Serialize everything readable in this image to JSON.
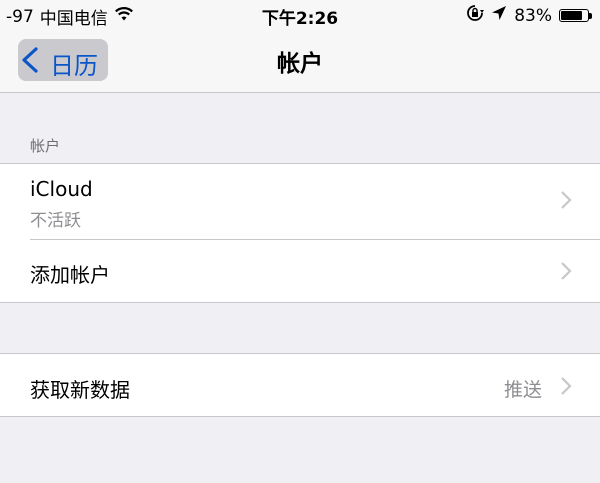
{
  "status_bar": {
    "signal": "-97",
    "carrier": "中国电信",
    "time": "下午2:26",
    "battery": "83%",
    "battery_level": 0.83,
    "icons": [
      "wifi-icon",
      "rotation-lock-icon",
      "location-arrow-icon",
      "battery-icon"
    ]
  },
  "nav": {
    "back_label": "日历",
    "title": "帐户"
  },
  "accounts_section": {
    "header": "帐户",
    "rows": [
      {
        "title": "iCloud",
        "subtitle": "不活跃"
      },
      {
        "title": "添加帐户"
      }
    ]
  },
  "fetch_section": {
    "title": "获取新数据",
    "value": "推送"
  },
  "colors": {
    "accent": "#0a56c8",
    "background": "#efeff4",
    "secondary_text": "#8e8e93"
  }
}
